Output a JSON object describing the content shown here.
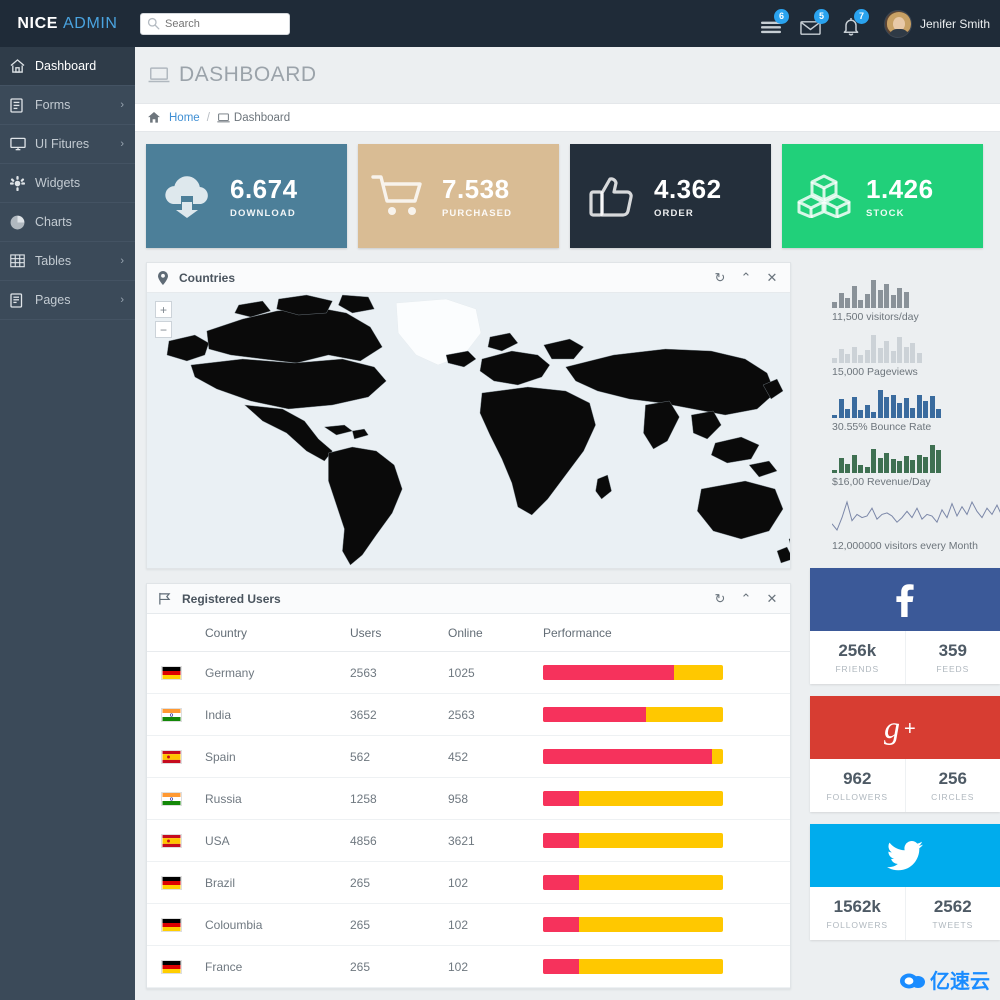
{
  "brand": {
    "part1": "NICE",
    "part2": "ADMIN"
  },
  "search": {
    "placeholder": "Search",
    "value": "",
    "icon": "search-icon"
  },
  "topnav": {
    "icons": [
      {
        "name": "tasks-icon",
        "badge": "6"
      },
      {
        "name": "envelope-icon",
        "badge": "5"
      },
      {
        "name": "bell-icon",
        "badge": "7"
      }
    ],
    "user": {
      "name": "Jenifer Smith",
      "avatar": "avatar"
    }
  },
  "sidebar": {
    "items": [
      {
        "label": "Dashboard",
        "icon": "home-icon",
        "active": true,
        "caret": ""
      },
      {
        "label": "Forms",
        "icon": "form-icon",
        "active": false,
        "caret": "›"
      },
      {
        "label": "UI Fitures",
        "icon": "monitor-icon",
        "active": false,
        "caret": "›"
      },
      {
        "label": "Widgets",
        "icon": "widgets-icon",
        "active": false,
        "caret": ""
      },
      {
        "label": "Charts",
        "icon": "pie-chart-icon",
        "active": false,
        "caret": ""
      },
      {
        "label": "Tables",
        "icon": "table-icon",
        "active": false,
        "caret": "›"
      },
      {
        "label": "Pages",
        "icon": "pages-icon",
        "active": false,
        "caret": "›"
      }
    ]
  },
  "page": {
    "title": "DASHBOARD",
    "title_icon": "laptop-icon",
    "breadcrumb": {
      "home": "Home",
      "separator": "/",
      "current": "Dashboard",
      "home_icon": "home-icon",
      "current_icon": "laptop-icon"
    }
  },
  "cards": [
    {
      "number": "6.674",
      "label": "DOWNLOAD",
      "color": "#4c7f99",
      "icon": "cloud-download-icon"
    },
    {
      "number": "7.538",
      "label": "PURCHASED",
      "color": "#d9bc94",
      "icon": "shopping-cart-icon"
    },
    {
      "number": "4.362",
      "label": "ORDER",
      "color": "#242f3b",
      "icon": "thumbs-up-icon"
    },
    {
      "number": "1.426",
      "label": "STOCK",
      "color": "#21d07a",
      "icon": "boxes-icon"
    }
  ],
  "countries_panel": {
    "title": "Countries",
    "icon": "map-marker-icon",
    "tools": [
      {
        "name": "refresh-icon",
        "glyph": "↻"
      },
      {
        "name": "collapse-icon",
        "glyph": "⌃"
      },
      {
        "name": "close-icon",
        "glyph": "✕"
      }
    ],
    "map": {
      "zoom_in": "+",
      "zoom_out": "−",
      "land_color": "#0a0a0a",
      "sea_color": "#eaf0f4",
      "highlight_region": "Greenland",
      "highlight_color": "#fbfdfe"
    }
  },
  "users_panel": {
    "title": "Registered Users",
    "icon": "flag-icon",
    "tools": [
      {
        "name": "refresh-icon",
        "glyph": "↻"
      },
      {
        "name": "collapse-icon",
        "glyph": "⌃"
      },
      {
        "name": "close-icon",
        "glyph": "✕"
      }
    ],
    "columns": [
      "",
      "Country",
      "Users",
      "Online",
      "Performance"
    ],
    "rows": [
      {
        "flag": "germany-flag",
        "country": "Germany",
        "users": "2563",
        "online": "1025",
        "performance_red_pct": 73
      },
      {
        "flag": "india-flag",
        "country": "India",
        "users": "3652",
        "online": "2563",
        "performance_red_pct": 57
      },
      {
        "flag": "spain-flag",
        "country": "Spain",
        "users": "562",
        "online": "452",
        "performance_red_pct": 94
      },
      {
        "flag": "india-flag",
        "country": "Russia",
        "users": "1258",
        "online": "958",
        "performance_red_pct": 20
      },
      {
        "flag": "spain-flag",
        "country": "USA",
        "users": "4856",
        "online": "3621",
        "performance_red_pct": 20
      },
      {
        "flag": "germany-flag",
        "country": "Brazil",
        "users": "265",
        "online": "102",
        "performance_red_pct": 20
      },
      {
        "flag": "germany-flag",
        "country": "Coloumbia",
        "users": "265",
        "online": "102",
        "performance_red_pct": 20
      },
      {
        "flag": "germany-flag",
        "country": "France",
        "users": "265",
        "online": "102",
        "performance_red_pct": 20
      }
    ]
  },
  "sparklines": [
    {
      "label": "11,500 visitors/day",
      "type": "bar",
      "color": "#8a9299",
      "values": [
        6,
        14,
        9,
        20,
        7,
        13,
        26,
        17,
        22,
        12,
        19,
        15
      ]
    },
    {
      "label": "15,000 Pageviews",
      "type": "bar",
      "color": "#ccd2d7",
      "values": [
        4,
        12,
        8,
        14,
        7,
        11,
        24,
        13,
        19,
        10,
        22,
        14,
        17,
        9
      ]
    },
    {
      "label": "30.55% Bounce Rate",
      "type": "bar",
      "color": "#3a6b9e",
      "values": [
        3,
        18,
        9,
        20,
        8,
        13,
        6,
        27,
        20,
        22,
        14,
        19,
        10,
        22,
        16,
        21,
        9
      ]
    },
    {
      "label": "$16,00 Revenue/Day",
      "type": "bar",
      "color": "#3f7052",
      "values": [
        3,
        14,
        8,
        17,
        7,
        6,
        22,
        14,
        19,
        13,
        11,
        16,
        12,
        17,
        15,
        26,
        21
      ]
    },
    {
      "label": "12,000000 visitors every Month",
      "type": "line",
      "color": "#7b87a8",
      "values": [
        8,
        4,
        12,
        22,
        10,
        14,
        12,
        13,
        18,
        11,
        14,
        15,
        13,
        9,
        12,
        16,
        12,
        18,
        11,
        14,
        13,
        9,
        17,
        12,
        21,
        13,
        19,
        14,
        22,
        16,
        12,
        18,
        14,
        20,
        13
      ]
    }
  ],
  "social": [
    {
      "network": "facebook",
      "icon": "facebook-icon",
      "glyph": "f",
      "color": "#3b5998",
      "stats": [
        {
          "value": "256k",
          "label": "FRIENDS"
        },
        {
          "value": "359",
          "label": "FEEDS"
        }
      ]
    },
    {
      "network": "google-plus",
      "icon": "google-plus-icon",
      "glyph": "g+",
      "color": "#d73d32",
      "stats": [
        {
          "value": "962",
          "label": "FOLLOWERS"
        },
        {
          "value": "256",
          "label": "CIRCLES"
        }
      ]
    },
    {
      "network": "twitter",
      "icon": "twitter-icon",
      "glyph": "🐦",
      "color": "#00aced",
      "stats": [
        {
          "value": "1562k",
          "label": "FOLLOWERS"
        },
        {
          "value": "2562",
          "label": "TWEETS"
        }
      ]
    }
  ],
  "watermark": {
    "text": "亿速云"
  }
}
